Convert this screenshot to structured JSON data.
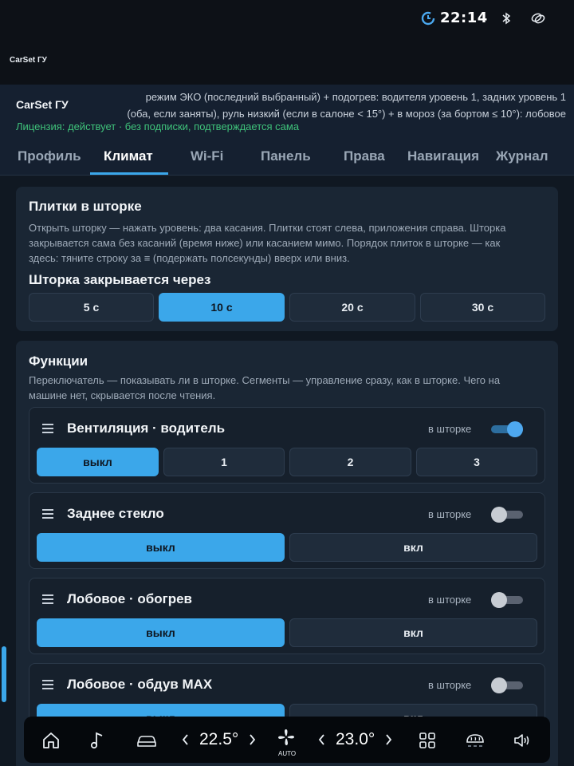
{
  "status": {
    "time": "22:14"
  },
  "app": {
    "title_small": "CarSet ГУ",
    "name": "CarSet ГУ"
  },
  "header": {
    "mode_line1": "режим ЭКО (последний выбранный) + подогрев: водителя уровень 1, задних уровень 1",
    "mode_line2": "(оба, если заняты), руль низкий (если в салоне < 15°) + в мороз (за бортом ≤ 10°): лобовое",
    "license": "Лицензия: действует · без подписки, подтверждается сама"
  },
  "tabs": [
    {
      "label": "Профиль",
      "active": false
    },
    {
      "label": "Климат",
      "active": true
    },
    {
      "label": "Wi-Fi",
      "active": false
    },
    {
      "label": "Панель",
      "active": false
    },
    {
      "label": "Права",
      "active": false
    },
    {
      "label": "Навигация",
      "active": false
    },
    {
      "label": "Журнал",
      "active": false
    }
  ],
  "tiles_card": {
    "title": "Плитки в шторке",
    "desc_line1": "Открыть шторку — нажать уровень: два касания. Плитки стоят слева, приложения справа. Шторка",
    "desc_line2": "закрывается сама без касаний (время ниже) или касанием мимо. Порядок плиток в шторке — как",
    "desc_line3": "здесь: тяните строку за ≡ (подержать полсекунды) вверх или вниз.",
    "close_title": "Шторка закрывается через",
    "close_options": [
      "5 с",
      "10 с",
      "20 с",
      "30 с"
    ],
    "close_selected": "10 с"
  },
  "functions_card": {
    "title": "Функции",
    "desc_line1": "Переключатель — показывать ли в шторке. Сегменты — управление сразу, как в шторке. Чего на",
    "desc_line2": "машине нет, скрывается после чтения.",
    "in_shade_label": "в шторке",
    "items": [
      {
        "title": "Вентиляция · водитель",
        "in_shade": true,
        "options": [
          "выкл",
          "1",
          "2",
          "3"
        ],
        "selected": "выкл"
      },
      {
        "title": "Заднее стекло",
        "in_shade": false,
        "options": [
          "выкл",
          "вкл"
        ],
        "selected": "выкл"
      },
      {
        "title": "Лобовое · обогрев",
        "in_shade": false,
        "options": [
          "выкл",
          "вкл"
        ],
        "selected": "выкл"
      },
      {
        "title": "Лобовое · обдув MAX",
        "in_shade": false,
        "options": [
          "выкл",
          "вкл"
        ],
        "selected": "выкл"
      }
    ]
  },
  "bottombar": {
    "temp_left": "22.5°",
    "temp_right": "23.0°",
    "fan_label": "AUTO"
  },
  "colors": {
    "accent": "#3ba7ea",
    "license": "#3fc27a",
    "background": "#101822",
    "card": "#1a2634"
  },
  "icons": [
    "clock-icon",
    "bluetooth-icon",
    "link-icon",
    "drag-handle-icon",
    "home-icon",
    "music-icon",
    "car-icon",
    "fan-icon",
    "apps-grid-icon",
    "rear-defrost-icon",
    "volume-icon",
    "chevron-left-icon",
    "chevron-right-icon"
  ]
}
